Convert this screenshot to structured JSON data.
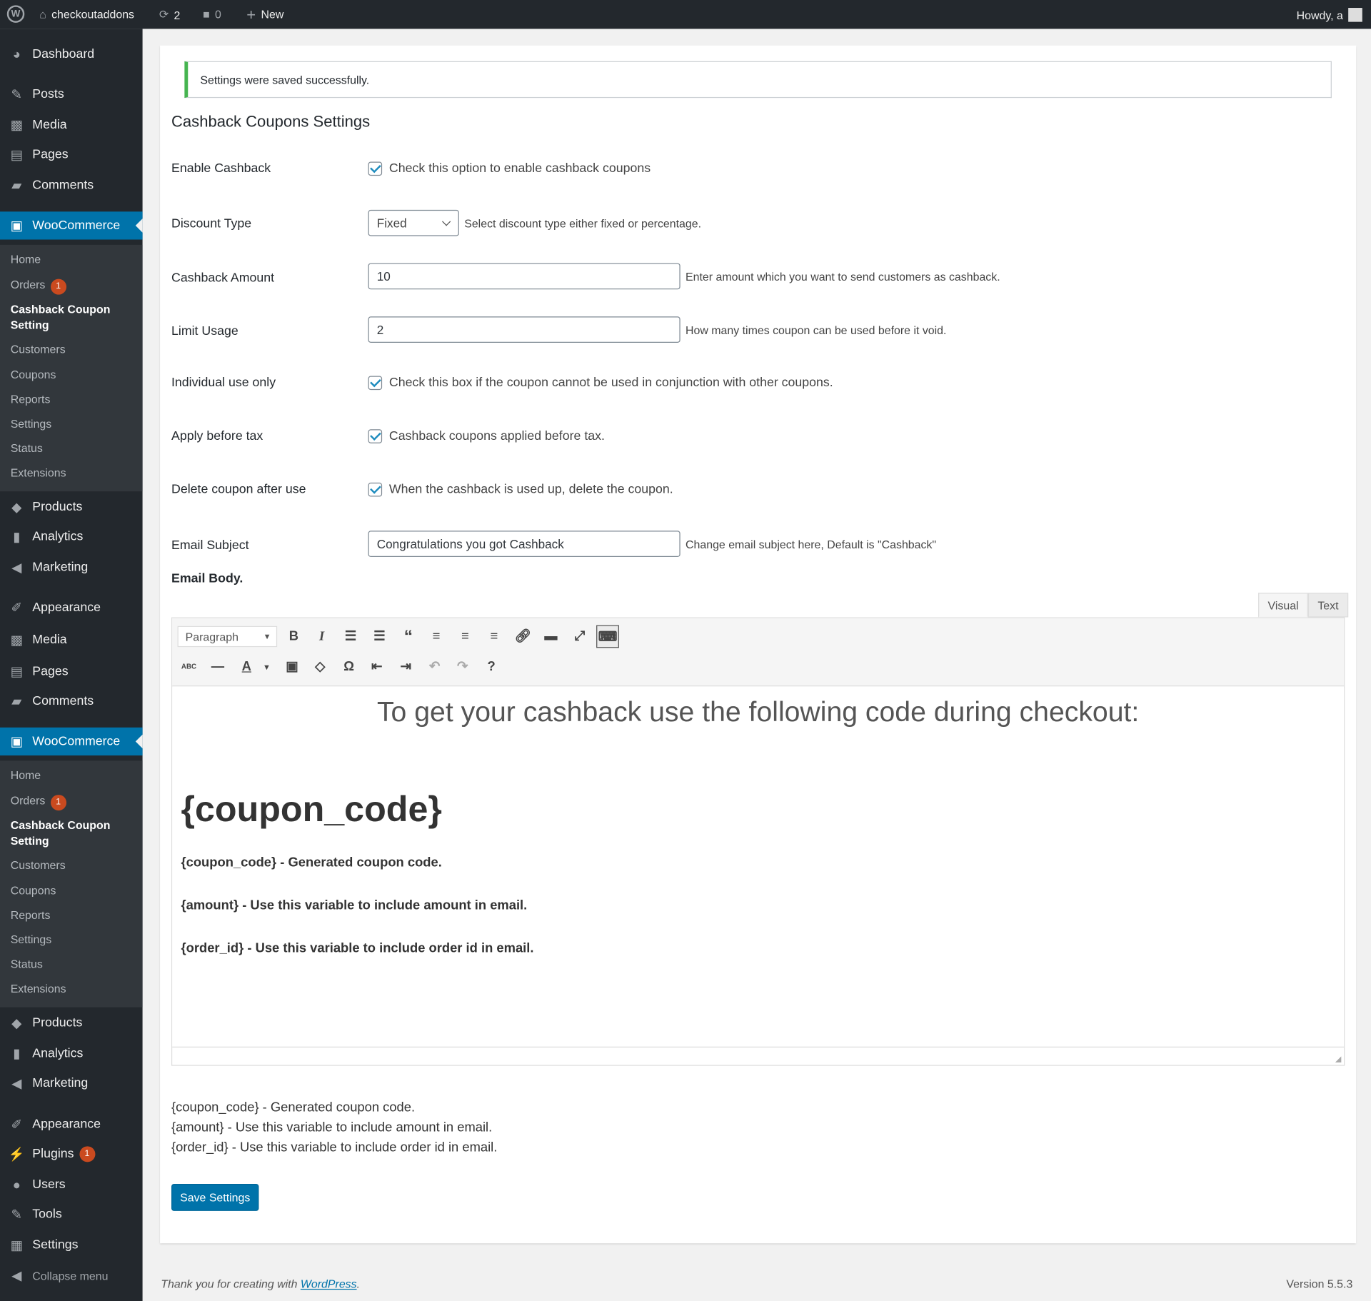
{
  "adminbar": {
    "site": "checkoutaddons",
    "updates": "2",
    "comments": "0",
    "new": "New",
    "howdy": "Howdy, a"
  },
  "sidebar": {
    "blocks": [
      {
        "main": [
          {
            "label": "Dashboard",
            "icon": "dashboard-icon"
          },
          {
            "label": "Posts",
            "icon": "pin-icon"
          },
          {
            "label": "Media",
            "icon": "media-icon"
          },
          {
            "label": "Pages",
            "icon": "pages-icon"
          },
          {
            "label": "Comments",
            "icon": "comment-icon"
          }
        ],
        "woo": "WooCommerce",
        "sub": [
          {
            "label": "Home"
          },
          {
            "label": "Orders",
            "badge": "1"
          },
          {
            "label": "Cashback Coupon Setting",
            "current": true
          },
          {
            "label": "Customers"
          },
          {
            "label": "Coupons"
          },
          {
            "label": "Reports"
          },
          {
            "label": "Settings"
          },
          {
            "label": "Status"
          },
          {
            "label": "Extensions"
          }
        ],
        "after": [
          {
            "label": "Products",
            "icon": "products-icon"
          },
          {
            "label": "Analytics",
            "icon": "analytics-icon"
          },
          {
            "label": "Marketing",
            "icon": "megaphone-icon"
          },
          {
            "label": "Appearance",
            "icon": "brush-icon"
          },
          {
            "label": "Media",
            "icon": "media-icon"
          },
          {
            "label": "Pages",
            "icon": "pages-icon"
          },
          {
            "label": "Comments",
            "icon": "comment-icon"
          }
        ]
      },
      {
        "woo": "WooCommerce",
        "sub": [
          {
            "label": "Home"
          },
          {
            "label": "Orders",
            "badge": "1"
          },
          {
            "label": "Cashback Coupon Setting",
            "current": true
          },
          {
            "label": "Customers"
          },
          {
            "label": "Coupons"
          },
          {
            "label": "Reports"
          },
          {
            "label": "Settings"
          },
          {
            "label": "Status"
          },
          {
            "label": "Extensions"
          }
        ],
        "after": [
          {
            "label": "Products",
            "icon": "products-icon"
          },
          {
            "label": "Analytics",
            "icon": "analytics-icon"
          },
          {
            "label": "Marketing",
            "icon": "megaphone-icon"
          },
          {
            "label": "Appearance",
            "icon": "brush-icon"
          },
          {
            "label": "Plugins",
            "icon": "plugin-icon",
            "badge": "1"
          },
          {
            "label": "Users",
            "icon": "user-icon"
          },
          {
            "label": "Tools",
            "icon": "wrench-icon"
          },
          {
            "label": "Settings",
            "icon": "settings-icon"
          },
          {
            "label": "Collapse menu",
            "icon": "collapse-icon"
          }
        ]
      }
    ]
  },
  "notice": "Settings were saved successfully.",
  "title": "Cashback Coupons Settings",
  "form": {
    "enable": {
      "label": "Enable Cashback",
      "desc": "Check this option to enable cashback coupons",
      "checked": true
    },
    "discount": {
      "label": "Discount Type",
      "value": "Fixed",
      "desc": "Select discount type either fixed or percentage."
    },
    "amount": {
      "label": "Cashback Amount",
      "value": "10",
      "desc": "Enter amount which you want to send customers as cashback."
    },
    "limit": {
      "label": "Limit Usage",
      "value": "2",
      "desc": "How many times coupon can be used before it void."
    },
    "individual": {
      "label": "Individual use only",
      "desc": "Check this box if the coupon cannot be used in conjunction with other coupons.",
      "checked": true
    },
    "beforetax": {
      "label": "Apply before tax",
      "desc": "Cashback coupons applied before tax.",
      "checked": true
    },
    "delete": {
      "label": "Delete coupon after use",
      "desc": "When the cashback is used up, delete the coupon.",
      "checked": true
    },
    "subject": {
      "label": "Email Subject",
      "value": "Congratulations you got Cashback",
      "desc": "Change email subject here, Default is \"Cashback\""
    },
    "body_label": "Email Body."
  },
  "editor": {
    "tab_visual": "Visual",
    "tab_text": "Text",
    "format": "Paragraph",
    "heading": "To get your cashback use the following code during checkout:",
    "code": "{coupon_code}",
    "lines": [
      "{coupon_code} - Generated coupon code.",
      "{amount} - Use this variable to include amount in email.",
      "{order_id} - Use this variable to include order id in email."
    ]
  },
  "vars": [
    "{coupon_code} - Generated coupon code.",
    "{amount} - Use this variable to include amount in email.",
    "{order_id} - Use this variable to include order id in email."
  ],
  "save": "Save Settings",
  "footer": {
    "thanks": "Thank you for creating with ",
    "link": "WordPress",
    "period": ".",
    "version": "Version 5.5.3"
  }
}
